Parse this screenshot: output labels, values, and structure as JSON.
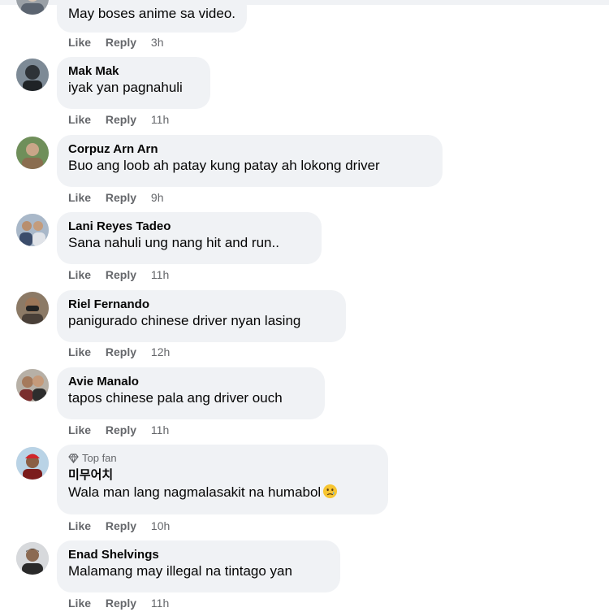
{
  "comments": [
    {
      "name": "",
      "text": "May boses anime sa video.",
      "like": "Like",
      "reply": "Reply",
      "time": "3h"
    },
    {
      "name": "Mak Mak",
      "text": "iyak yan pagnahuli",
      "like": "Like",
      "reply": "Reply",
      "time": "11h"
    },
    {
      "name": "Corpuz Arn Arn",
      "text": "Buo ang loob ah patay kung patay ah lokong driver",
      "like": "Like",
      "reply": "Reply",
      "time": "9h"
    },
    {
      "name": "Lani Reyes Tadeo",
      "text": "Sana nahuli ung nang hit and run..",
      "like": "Like",
      "reply": "Reply",
      "time": "11h"
    },
    {
      "name": "Riel Fernando",
      "text": "panigurado chinese driver nyan lasing",
      "like": "Like",
      "reply": "Reply",
      "time": "12h"
    },
    {
      "name": "Avie Manalo",
      "text": "tapos chinese pala ang driver ouch",
      "like": "Like",
      "reply": "Reply",
      "time": "11h"
    },
    {
      "name": "미무어치",
      "badge": "Top fan",
      "text": "Wala man lang nagmalasakit na humabol",
      "emoji": "face-with-tear-emoji",
      "like": "Like",
      "reply": "Reply",
      "time": "10h"
    },
    {
      "name": "Enad Shelvings",
      "text": "Malamang may illegal na tintago yan",
      "like": "Like",
      "reply": "Reply",
      "time": "11h"
    }
  ]
}
